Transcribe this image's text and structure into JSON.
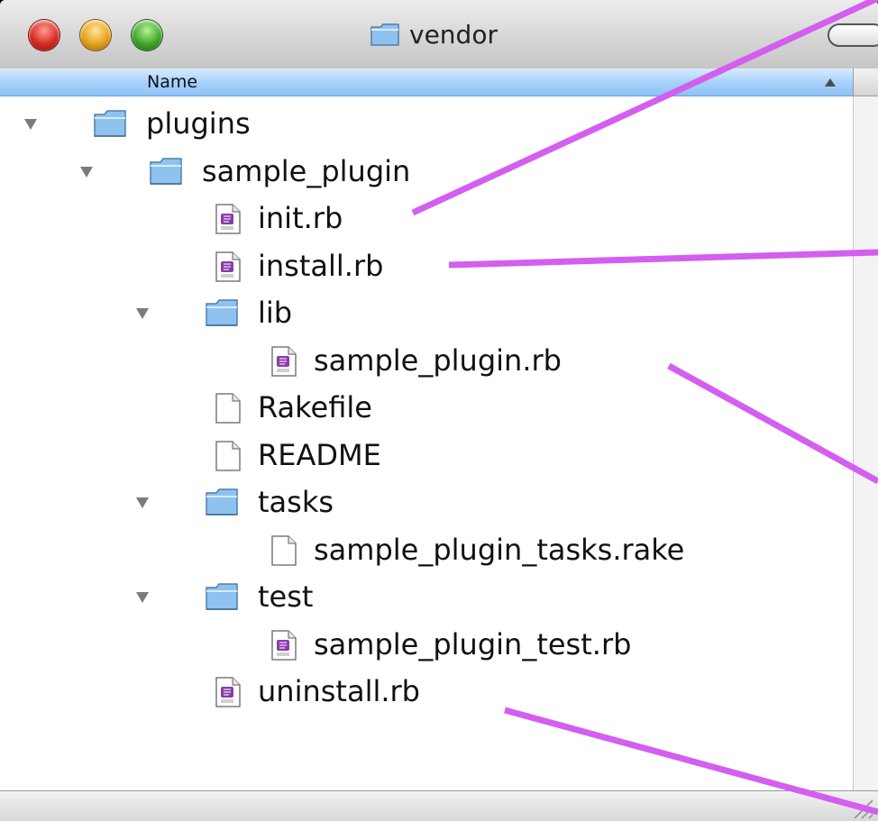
{
  "window": {
    "title": "vendor"
  },
  "header": {
    "name_column": "Name"
  },
  "tree": [
    {
      "label": "plugins",
      "type": "folder",
      "expanded": true,
      "depth": 0
    },
    {
      "label": "sample_plugin",
      "type": "folder",
      "expanded": true,
      "depth": 1
    },
    {
      "label": "init.rb",
      "type": "ruby-file",
      "depth": 2
    },
    {
      "label": "install.rb",
      "type": "ruby-file",
      "depth": 2
    },
    {
      "label": "lib",
      "type": "folder",
      "expanded": true,
      "depth": 2
    },
    {
      "label": "sample_plugin.rb",
      "type": "ruby-file",
      "depth": 3
    },
    {
      "label": "Rakefile",
      "type": "plain-file",
      "depth": 2
    },
    {
      "label": "README",
      "type": "plain-file",
      "depth": 2
    },
    {
      "label": "tasks",
      "type": "folder",
      "expanded": true,
      "depth": 2
    },
    {
      "label": "sample_plugin_tasks.rake",
      "type": "plain-file",
      "depth": 3
    },
    {
      "label": "test",
      "type": "folder",
      "expanded": true,
      "depth": 2
    },
    {
      "label": "sample_plugin_test.rb",
      "type": "ruby-file",
      "depth": 3
    },
    {
      "label": "uninstall.rb",
      "type": "ruby-file",
      "depth": 2
    }
  ],
  "colors": {
    "accent_line": "#d35ef0",
    "header_blue": "#a9d2fb",
    "folder_blue": "#8fc3ef"
  }
}
